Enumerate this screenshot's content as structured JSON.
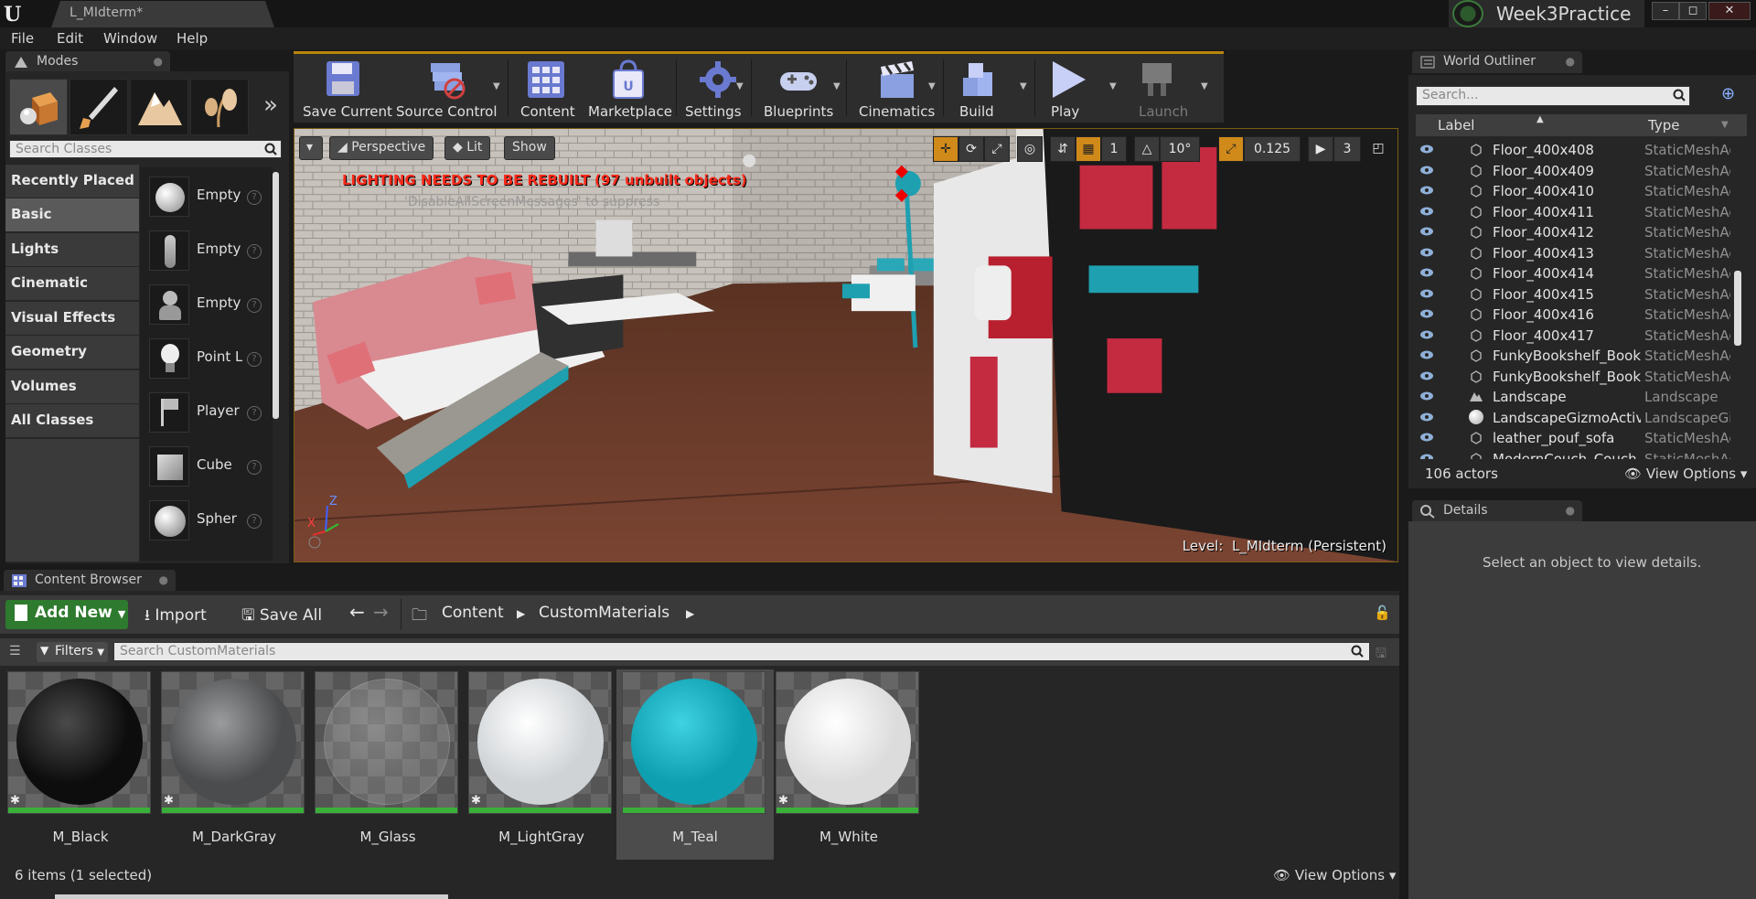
{
  "window": {
    "document_tab": "L_MIdterm*",
    "project_name": "Week3Practice",
    "controls": [
      "–",
      "◻",
      "✕"
    ]
  },
  "menu": [
    "File",
    "Edit",
    "Window",
    "Help"
  ],
  "modes": {
    "tab_label": "Modes",
    "search_placeholder": "Search Classes",
    "categories": [
      "Recently Placed",
      "Basic",
      "Lights",
      "Cinematic",
      "Visual Effects",
      "Geometry",
      "Volumes",
      "All Classes"
    ],
    "active_category": "Basic",
    "placeables": [
      "Empty",
      "Empty",
      "Empty",
      "Point L",
      "Player",
      "Cube",
      "Spher"
    ]
  },
  "toolbar": {
    "items": [
      "Save Current",
      "Source Control",
      "Content",
      "Marketplace",
      "Settings",
      "Blueprints",
      "Cinematics",
      "Build",
      "Play",
      "Launch"
    ]
  },
  "viewport": {
    "perspective": "Perspective",
    "lit": "Lit",
    "show": "Show",
    "warning": "LIGHTING NEEDS TO BE REBUILT (97 unbuilt objects)",
    "suppress": "'DisableAllScreenMessages' to suppress",
    "level_label": "Level:",
    "level_name": "L_MIdterm (Persistent)",
    "grid_snap": "1",
    "rotation_snap": "10°",
    "scale_snap": "0.125",
    "camera_speed": "3",
    "axis_z": "Z",
    "axis_x": "X"
  },
  "outliner": {
    "tab_label": "World Outliner",
    "search_placeholder": "Search...",
    "col_label": "Label",
    "col_type": "Type",
    "rows": [
      {
        "label": "Floor_400x408",
        "type": "StaticMeshAc"
      },
      {
        "label": "Floor_400x409",
        "type": "StaticMeshAc"
      },
      {
        "label": "Floor_400x410",
        "type": "StaticMeshAc"
      },
      {
        "label": "Floor_400x411",
        "type": "StaticMeshAc"
      },
      {
        "label": "Floor_400x412",
        "type": "StaticMeshAc"
      },
      {
        "label": "Floor_400x413",
        "type": "StaticMeshAc"
      },
      {
        "label": "Floor_400x414",
        "type": "StaticMeshAc"
      },
      {
        "label": "Floor_400x415",
        "type": "StaticMeshAc"
      },
      {
        "label": "Floor_400x416",
        "type": "StaticMeshAc"
      },
      {
        "label": "Floor_400x417",
        "type": "StaticMeshAc"
      },
      {
        "label": "FunkyBookshelf_Booksh",
        "type": "StaticMeshAc"
      },
      {
        "label": "FunkyBookshelf_Booksh",
        "type": "StaticMeshAc"
      },
      {
        "label": "Landscape",
        "type": "Landscape"
      },
      {
        "label": "LandscapeGizmoActiveA",
        "type": "LandscapeGiz"
      },
      {
        "label": "leather_pouf_sofa",
        "type": "StaticMeshAc"
      },
      {
        "label": "ModernCouch_Couch_B",
        "type": "StaticMeshAc"
      }
    ],
    "actor_count": "106 actors",
    "view_options": "View Options"
  },
  "details": {
    "tab_label": "Details",
    "empty_message": "Select an object to view details."
  },
  "content_browser": {
    "tab_label": "Content Browser",
    "add_new": "Add New",
    "import": "Import",
    "save_all": "Save All",
    "path": [
      "Content",
      "CustomMaterials"
    ],
    "filters": "Filters",
    "search_placeholder": "Search CustomMaterials",
    "assets": [
      {
        "name": "M_Black",
        "color": "#0d0d0d",
        "highlight": "#4a4a4a"
      },
      {
        "name": "M_DarkGray",
        "color": "#4a4c4e",
        "highlight": "#9a9c9e"
      },
      {
        "name": "M_Glass",
        "color": "rgba(200,200,200,0.18)",
        "highlight": "rgba(255,255,255,0.25)"
      },
      {
        "name": "M_LightGray",
        "color": "#cfd3d6",
        "highlight": "#ffffff"
      },
      {
        "name": "M_Teal",
        "color": "#0e9fb0",
        "highlight": "#3fd2e2"
      },
      {
        "name": "M_White",
        "color": "#dcdcdc",
        "highlight": "#ffffff"
      }
    ],
    "selected_asset": "M_Teal",
    "status": "6 items (1 selected)",
    "view_options": "View Options"
  }
}
